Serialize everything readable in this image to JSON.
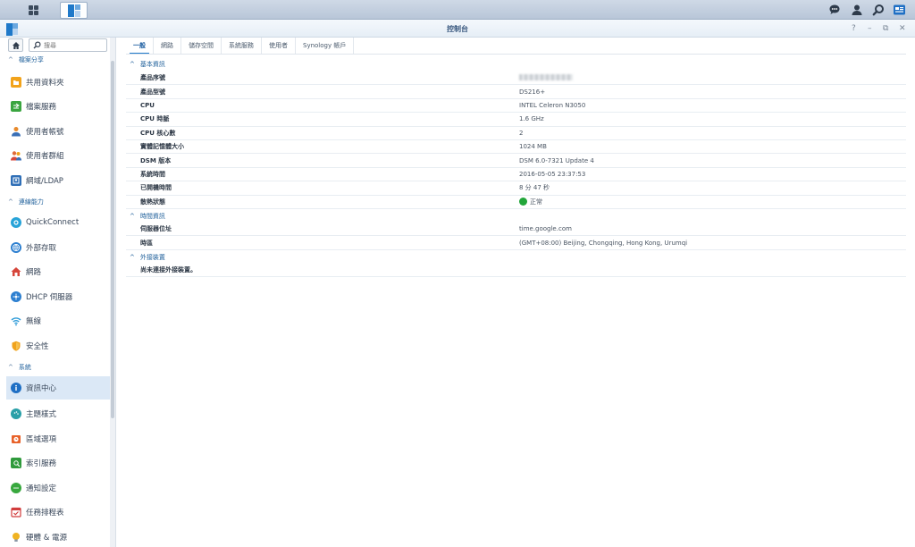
{
  "taskbar": {
    "icons": [
      "main-menu-icon",
      "control-panel-app-icon",
      "chat-icon",
      "user-icon",
      "search-icon",
      "widgets-icon"
    ]
  },
  "window": {
    "title": "控制台",
    "controls": [
      "?",
      "–",
      "⧉",
      "✕"
    ]
  },
  "sidebar": {
    "search_placeholder": "搜尋",
    "sections": [
      {
        "label": "檔案分享",
        "items": [
          {
            "label": "共用資料夾",
            "icon": "folder-share-icon",
            "color": "#f2a31b"
          },
          {
            "label": "檔案服務",
            "icon": "file-services-icon",
            "color": "#3aa540"
          },
          {
            "label": "使用者帳號",
            "icon": "user-icon",
            "color": "#e88a2c"
          },
          {
            "label": "使用者群組",
            "icon": "group-icon",
            "color": "#e06a3a"
          },
          {
            "label": "網域/LDAP",
            "icon": "domain-icon",
            "color": "#2f6fb7"
          }
        ]
      },
      {
        "label": "連線能力",
        "items": [
          {
            "label": "QuickConnect",
            "icon": "quickconnect-icon",
            "color": "#27a3d8"
          },
          {
            "label": "外部存取",
            "icon": "globe-icon",
            "color": "#2c7fd0"
          },
          {
            "label": "網路",
            "icon": "network-house-icon",
            "color": "#d6463b"
          },
          {
            "label": "DHCP 伺服器",
            "icon": "dhcp-icon",
            "color": "#2c7fd0"
          },
          {
            "label": "無線",
            "icon": "wifi-icon",
            "color": "#2c9ad8"
          },
          {
            "label": "安全性",
            "icon": "shield-icon",
            "color": "#f0a21c"
          }
        ]
      },
      {
        "label": "系統",
        "items": [
          {
            "label": "資訊中心",
            "icon": "info-icon",
            "color": "#1f6fc4",
            "active": true
          },
          {
            "label": "主題樣式",
            "icon": "palette-icon",
            "color": "#2aa0a8"
          },
          {
            "label": "區域選項",
            "icon": "regional-options-icon",
            "color": "#e8622a"
          },
          {
            "label": "索引服務",
            "icon": "index-service-icon",
            "color": "#2f9a3c"
          },
          {
            "label": "通知設定",
            "icon": "notification-icon",
            "color": "#38a83e"
          },
          {
            "label": "任務排程表",
            "icon": "calendar-icon",
            "color": "#d13c3c"
          },
          {
            "label": "硬體 & 電源",
            "icon": "bulb-icon",
            "color": "#f0b322"
          }
        ]
      }
    ]
  },
  "tabs": [
    "一般",
    "網路",
    "儲存空間",
    "系統服務",
    "使用者",
    "Synology 帳戶"
  ],
  "groups": [
    {
      "label": "基本資訊",
      "rows": [
        {
          "key": "產品序號",
          "value": "",
          "blurred": true
        },
        {
          "key": "產品型號",
          "value": "DS216+"
        },
        {
          "key": "CPU",
          "value": "INTEL Celeron N3050"
        },
        {
          "key": "CPU 時脈",
          "value": "1.6 GHz"
        },
        {
          "key": "CPU 核心數",
          "value": "2"
        },
        {
          "key": "實體記憶體大小",
          "value": "1024 MB"
        },
        {
          "key": "DSM 版本",
          "value": "DSM 6.0-7321 Update 4"
        },
        {
          "key": "系統時間",
          "value": "2016-05-05 23:37:53"
        },
        {
          "key": "已開機時間",
          "value": "8 分 47 秒"
        },
        {
          "key": "散熱狀態",
          "value": "正常",
          "status": "ok"
        }
      ]
    },
    {
      "label": "時間資訊",
      "rows": [
        {
          "key": "伺服器位址",
          "value": "time.google.com"
        },
        {
          "key": "時區",
          "value": "(GMT+08:00) Beijing, Chongqing, Hong Kong, Urumqi"
        }
      ]
    },
    {
      "label": "外接裝置",
      "rows": [
        {
          "key": "尚未連接外接裝置。",
          "value": ""
        }
      ]
    }
  ],
  "colors": {
    "accent": "#1f79c9",
    "ok": "#22a63a"
  }
}
